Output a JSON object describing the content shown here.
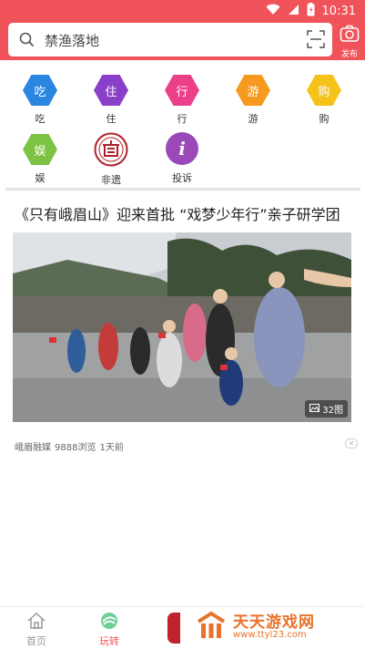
{
  "status_bar": {
    "time": "10:31"
  },
  "search": {
    "placeholder": "禁渔落地",
    "publish_label": "发布"
  },
  "categories": [
    {
      "label": "吃",
      "icon_text": "吃",
      "color": "#2a86e0"
    },
    {
      "label": "住",
      "icon_text": "住",
      "color": "#8a3fc8"
    },
    {
      "label": "行",
      "icon_text": "行",
      "color": "#ec3f8a"
    },
    {
      "label": "游",
      "icon_text": "游",
      "color": "#f59a1f"
    },
    {
      "label": "购",
      "icon_text": "购",
      "color": "#f5c21a"
    },
    {
      "label": "娱",
      "icon_text": "娱",
      "color": "#7cc243"
    },
    {
      "label": "非遗",
      "icon": "heritage-seal-icon",
      "color": "#b0202a"
    },
    {
      "label": "投诉",
      "icon_text": "i",
      "color": "#9b48b8"
    }
  ],
  "article": {
    "title": "《只有峨眉山》迎来首批 “戏梦少年行”亲子研学团",
    "photo_count": "32图",
    "source": "峨眉融媒",
    "views": "9888浏览",
    "time": "1天前"
  },
  "bottom_nav": {
    "home_label": "首页",
    "play_label": "玩转",
    "accent_color": "#f0535a"
  },
  "watermark": {
    "title": "天天游戏网",
    "url": "www.ttyl23.com"
  }
}
